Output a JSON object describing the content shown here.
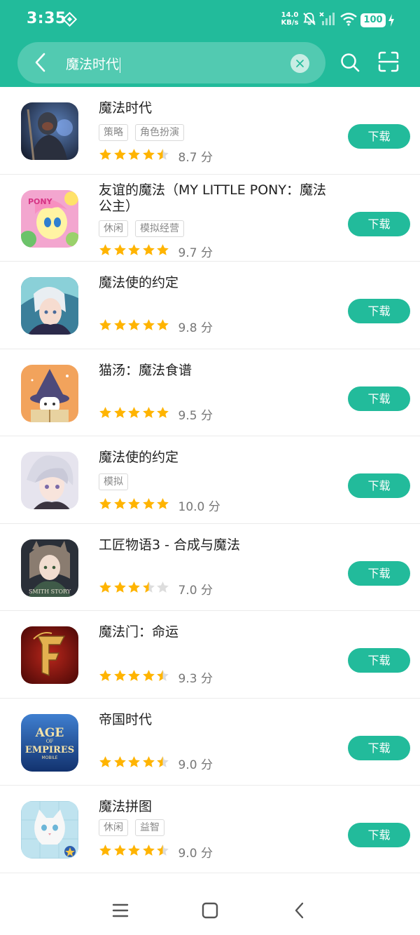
{
  "status_bar": {
    "time": "3:35",
    "speed_value": "14.0",
    "speed_unit": "KB/s",
    "battery": "100"
  },
  "search": {
    "query": "魔法时代"
  },
  "download_label": "下载",
  "score_unit": "分",
  "apps": [
    {
      "name": "魔法时代",
      "tags": [
        "策略",
        "角色扮演"
      ],
      "rating": 4.5,
      "score": "8.7",
      "icon": "dark-warrior-art"
    },
    {
      "name": "友谊的魔法（MY LITTLE PONY：魔法公主）",
      "tags": [
        "休闲",
        "模拟经营"
      ],
      "rating": 5,
      "score": "9.7",
      "icon": "pink-pony-art"
    },
    {
      "name": "魔法使的约定",
      "tags": [],
      "rating": 5,
      "score": "9.8",
      "icon": "anime-boy-art"
    },
    {
      "name": "猫汤：魔法食谱",
      "tags": [],
      "rating": 5,
      "score": "9.5",
      "icon": "white-cat-wizard-art"
    },
    {
      "name": "魔法使的约定",
      "tags": [
        "模拟"
      ],
      "rating": 5,
      "score": "10.0",
      "icon": "anime-silver-hair-art"
    },
    {
      "name": "工匠物语3 - 合成与魔法",
      "tags": [],
      "rating": 3.5,
      "score": "7.0",
      "icon": "smith-story-art"
    },
    {
      "name": "魔法门：命运",
      "tags": [],
      "rating": 4.5,
      "score": "9.3",
      "icon": "gold-f-logo"
    },
    {
      "name": "帝国时代",
      "tags": [],
      "rating": 4.5,
      "score": "9.0",
      "icon": "age-of-empires-logo"
    },
    {
      "name": "魔法拼图",
      "tags": [
        "休闲",
        "益智"
      ],
      "rating": 4.5,
      "score": "9.0",
      "icon": "white-cat-puzzle-art"
    }
  ],
  "logo_text": {
    "pony": "PONY",
    "smith": "SMITH STORY",
    "aoe_top": "AGE",
    "aoe_of": "OF",
    "aoe_main": "EMPIRES",
    "aoe_sub": "MOBILE"
  },
  "colors": {
    "accent": "#22bb9b",
    "star": "#ffb400",
    "star_empty": "#dddddd"
  }
}
